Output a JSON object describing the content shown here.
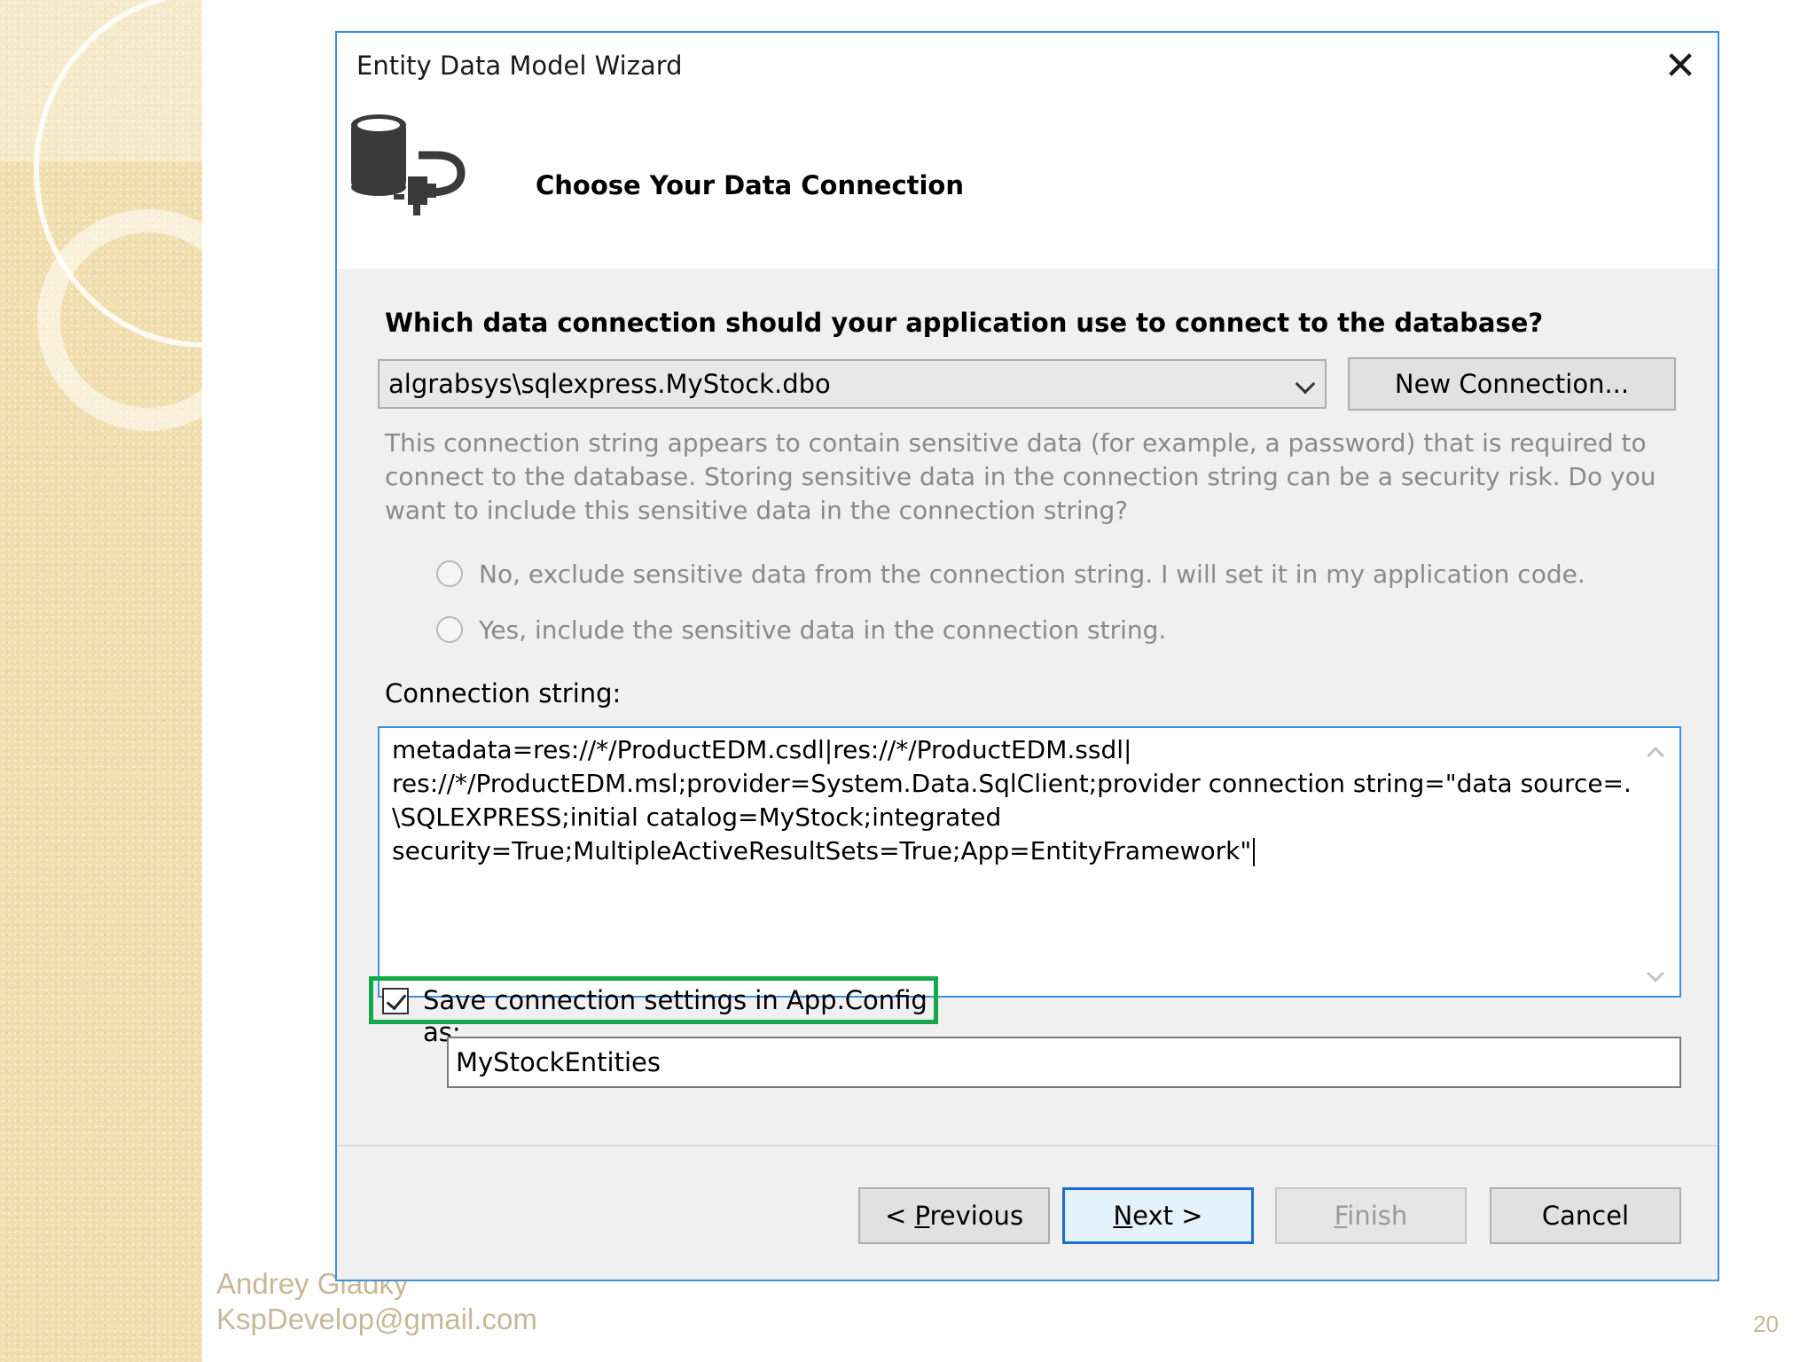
{
  "dialog": {
    "title": "Entity Data Model Wizard",
    "close_icon": "close-icon",
    "header_icon": "database-plug-icon",
    "step_title": "Choose Your Data Connection"
  },
  "connection": {
    "question": "Which data connection should your application use to connect to the database?",
    "selected": "algrabsys\\sqlexpress.MyStock.dbo",
    "new_connection_label": "New Connection...",
    "warning": "This connection string appears to contain sensitive data (for example, a password) that is required to connect to the database. Storing sensitive data in the connection string can be a security risk. Do you want to include this sensitive data in the connection string?",
    "option_no": "No, exclude sensitive data from the connection string. I will set it in my application code.",
    "option_yes": "Yes, include the sensitive data in the connection string.",
    "string_label": "Connection string:",
    "string_lines": [
      "metadata=res://*/ProductEDM.csdl|res://*/ProductEDM.ssdl|",
      "res://*/ProductEDM.msl;provider=System.Data.SqlClient;provider connection string=\"data source=.",
      "\\SQLEXPRESS;initial catalog=MyStock;integrated",
      "security=True;MultipleActiveResultSets=True;App=EntityFramework\""
    ],
    "save_label": "Save connection settings in App.Config as:",
    "save_checked": true,
    "entities_name": "MyStockEntities"
  },
  "buttons": {
    "previous_prefix": "< ",
    "previous_key": "P",
    "previous_rest": "revious",
    "next_key": "N",
    "next_rest": "ext >",
    "finish_key": "F",
    "finish_rest": "inish",
    "cancel": "Cancel"
  },
  "slide": {
    "author": "Andrey Gladky",
    "email": "KspDevelop@gmail.com",
    "page": "20"
  },
  "colors": {
    "accent_border": "#3c8fd8",
    "highlight_green": "#15a84a",
    "strip_background": "#f1deae"
  }
}
